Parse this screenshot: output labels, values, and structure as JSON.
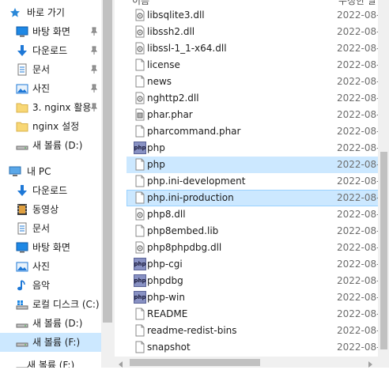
{
  "quick_access": {
    "header": "바로 가기",
    "items": [
      {
        "label": "바탕 화면",
        "icon": "desktop-icon",
        "pinned": true
      },
      {
        "label": "다운로드",
        "icon": "download-icon",
        "pinned": true
      },
      {
        "label": "문서",
        "icon": "document-icon",
        "pinned": true
      },
      {
        "label": "사진",
        "icon": "pictures-icon",
        "pinned": true
      },
      {
        "label": "3. nginx 활용",
        "icon": "folder-icon",
        "pinned": true
      },
      {
        "label": "nginx 설정",
        "icon": "folder-icon",
        "pinned": false
      },
      {
        "label": "새 볼륨 (D:)",
        "icon": "drive-icon",
        "pinned": false
      }
    ]
  },
  "this_pc": {
    "header": "내 PC",
    "items": [
      {
        "label": "다운로드",
        "icon": "download-icon"
      },
      {
        "label": "동영상",
        "icon": "video-icon"
      },
      {
        "label": "문서",
        "icon": "document-icon"
      },
      {
        "label": "바탕 화면",
        "icon": "desktop-icon"
      },
      {
        "label": "사진",
        "icon": "pictures-icon"
      },
      {
        "label": "음악",
        "icon": "music-icon"
      },
      {
        "label": "로컬 디스크 (C:)",
        "icon": "windows-drive-icon"
      },
      {
        "label": "새 볼륨 (D:)",
        "icon": "drive-icon"
      },
      {
        "label": "새 볼륨 (F:)",
        "icon": "drive-icon",
        "selected": true
      },
      {
        "label": "새 볼륨 (F:)",
        "icon": "drive-icon"
      }
    ]
  },
  "columns": {
    "name": "이름",
    "date": "수정한 날"
  },
  "files": [
    {
      "name": "libsqlite3.dll",
      "icon": "dll-icon",
      "date": "2022-08-"
    },
    {
      "name": "libssh2.dll",
      "icon": "dll-icon",
      "date": "2022-08-"
    },
    {
      "name": "libssl-1_1-x64.dll",
      "icon": "dll-icon",
      "date": "2022-08-"
    },
    {
      "name": "license",
      "icon": "file-icon",
      "date": "2022-08-"
    },
    {
      "name": "news",
      "icon": "file-icon",
      "date": "2022-08-"
    },
    {
      "name": "nghttp2.dll",
      "icon": "dll-icon",
      "date": "2022-08-"
    },
    {
      "name": "phar.phar",
      "icon": "phar-icon",
      "date": "2022-08-"
    },
    {
      "name": "pharcommand.phar",
      "icon": "file-icon",
      "date": "2022-08-"
    },
    {
      "name": "php",
      "icon": "php-icon",
      "date": "2022-08-"
    },
    {
      "name": "php",
      "icon": "file-icon",
      "date": "2022-08-",
      "state": "hover"
    },
    {
      "name": "php.ini-development",
      "icon": "file-icon",
      "date": "2022-08-"
    },
    {
      "name": "php.ini-production",
      "icon": "file-icon",
      "date": "2022-08-",
      "state": "selected"
    },
    {
      "name": "php8.dll",
      "icon": "dll-icon",
      "date": "2022-08-"
    },
    {
      "name": "php8embed.lib",
      "icon": "file-icon",
      "date": "2022-08-"
    },
    {
      "name": "php8phpdbg.dll",
      "icon": "dll-icon",
      "date": "2022-08-"
    },
    {
      "name": "php-cgi",
      "icon": "php-icon",
      "date": "2022-08-"
    },
    {
      "name": "phpdbg",
      "icon": "php-icon",
      "date": "2022-08-"
    },
    {
      "name": "php-win",
      "icon": "php-icon",
      "date": "2022-08-"
    },
    {
      "name": "README",
      "icon": "file-icon",
      "date": "2022-08-"
    },
    {
      "name": "readme-redist-bins",
      "icon": "file-icon",
      "date": "2022-08-"
    },
    {
      "name": "snapshot",
      "icon": "file-icon",
      "date": "2022-08-"
    }
  ],
  "colors": {
    "selection": "#cce8ff",
    "selection_border": "#99d1ff",
    "folder": "#f8d775",
    "accent": "#0078d7"
  },
  "php_icon_text": "php"
}
